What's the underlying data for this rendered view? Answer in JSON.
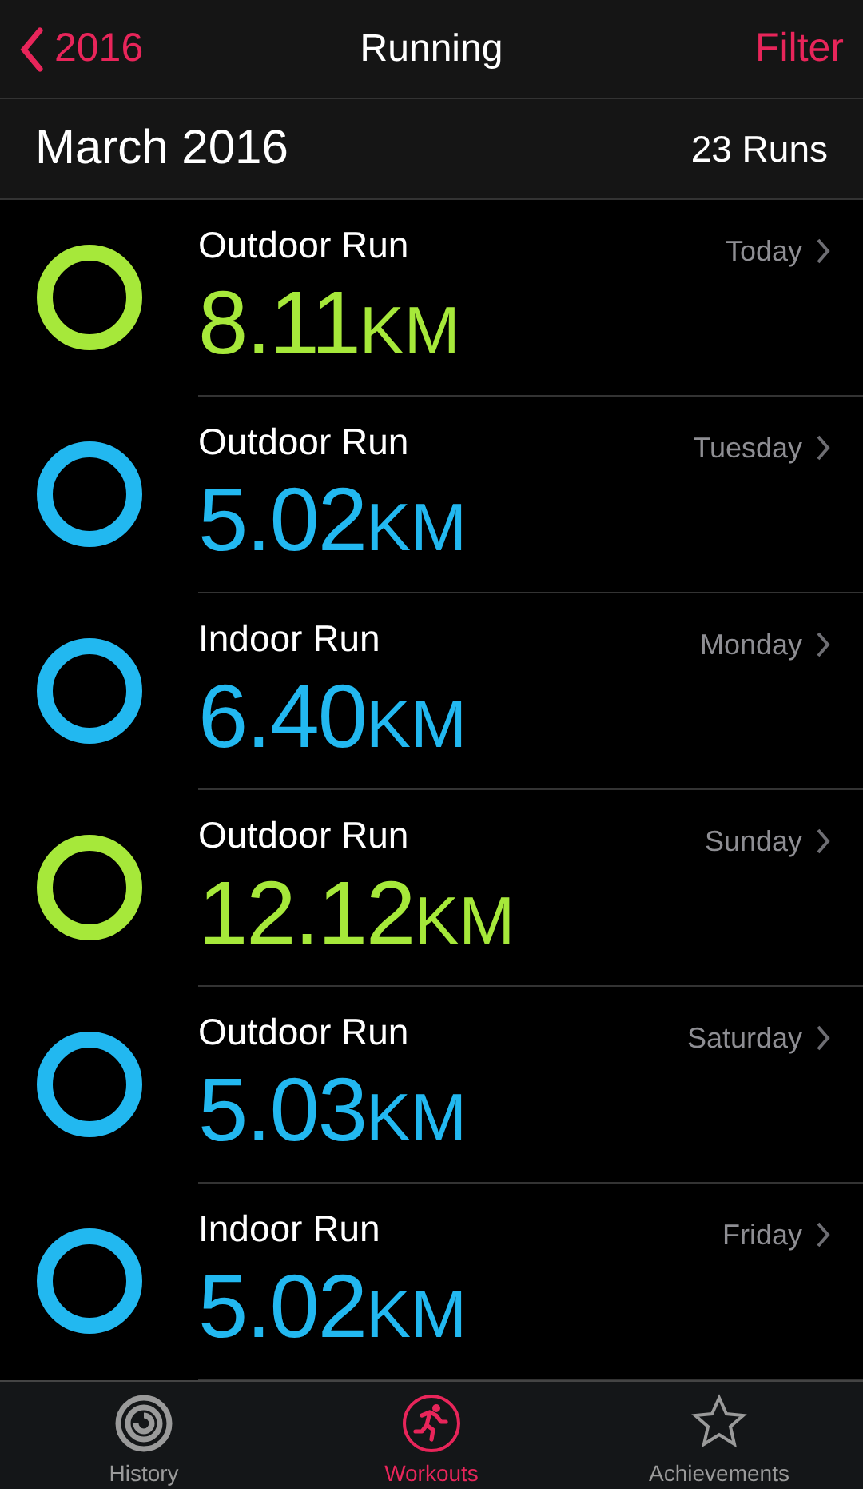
{
  "nav": {
    "back": "2016",
    "title": "Running",
    "action": "Filter"
  },
  "section": {
    "title": "March 2016",
    "count": "23 Runs"
  },
  "runs": [
    {
      "name": "Outdoor Run",
      "distance": "8.11",
      "unit": "KM",
      "day": "Today",
      "color": "#a6e83a"
    },
    {
      "name": "Outdoor Run",
      "distance": "5.02",
      "unit": "KM",
      "day": "Tuesday",
      "color": "#22b8f0"
    },
    {
      "name": "Indoor Run",
      "distance": "6.40",
      "unit": "KM",
      "day": "Monday",
      "color": "#22b8f0"
    },
    {
      "name": "Outdoor Run",
      "distance": "12.12",
      "unit": "KM",
      "day": "Sunday",
      "color": "#a6e83a"
    },
    {
      "name": "Outdoor Run",
      "distance": "5.03",
      "unit": "KM",
      "day": "Saturday",
      "color": "#22b8f0"
    },
    {
      "name": "Indoor Run",
      "distance": "5.02",
      "unit": "KM",
      "day": "Friday",
      "color": "#22b8f0"
    }
  ],
  "tabs": [
    {
      "label": "History",
      "kind": "history",
      "selected": false
    },
    {
      "label": "Workouts",
      "kind": "workouts",
      "selected": true
    },
    {
      "label": "Achievements",
      "kind": "achievements",
      "selected": false
    }
  ]
}
